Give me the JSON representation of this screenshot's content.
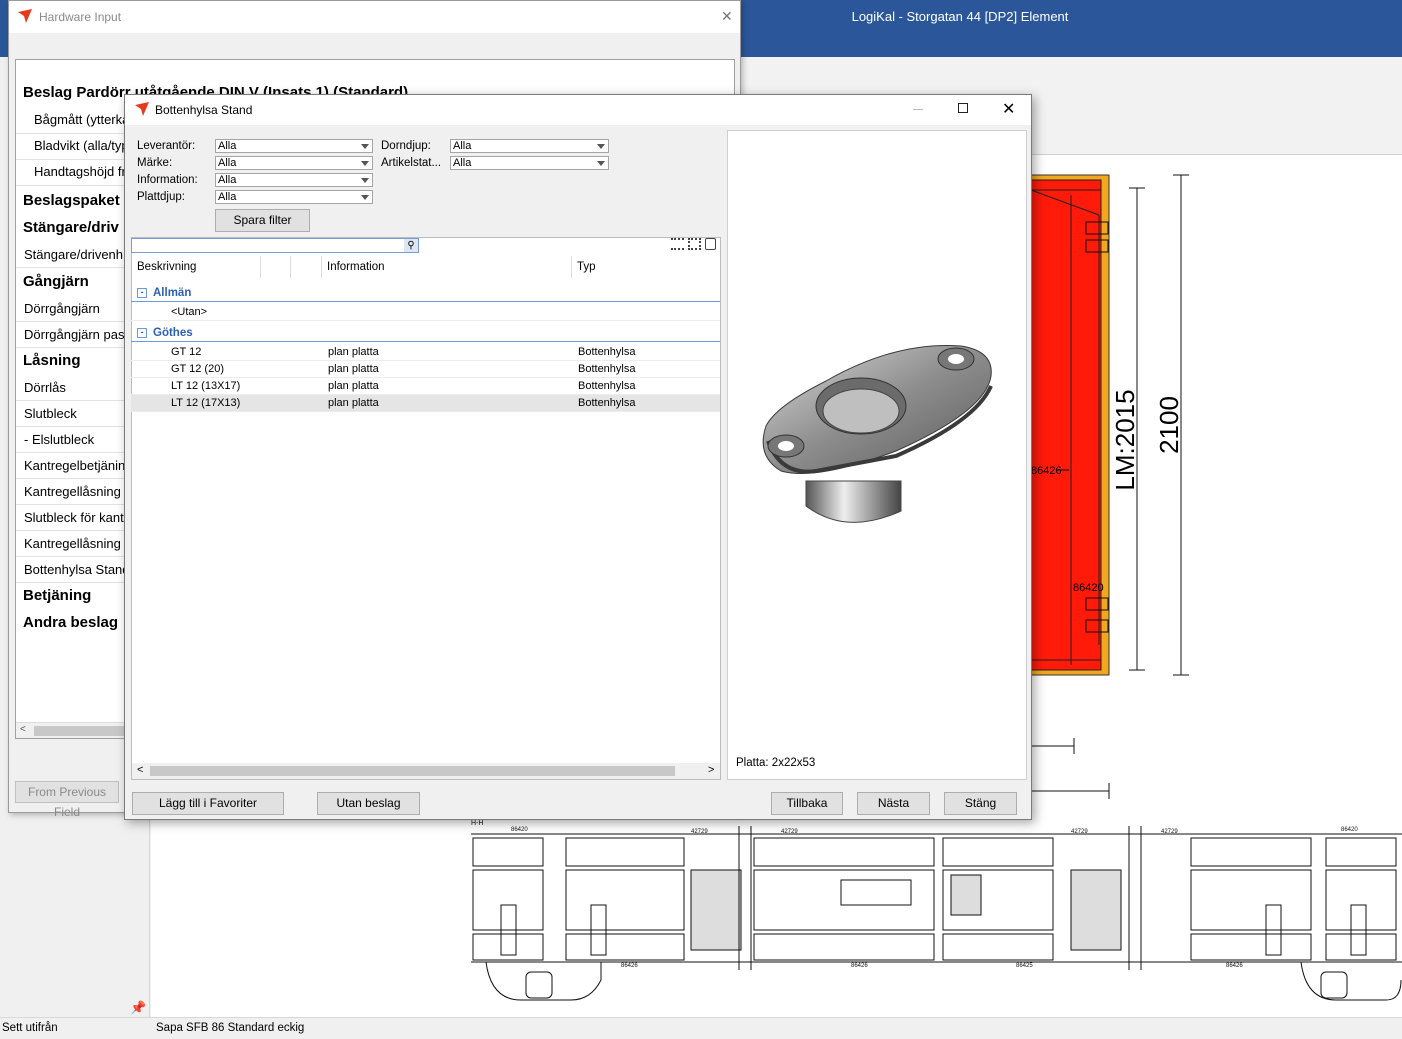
{
  "app": {
    "title": "LogiKal - Storgatan 44 [DP2] Element"
  },
  "status": {
    "left": "Sett utifrån",
    "profile": "Sapa SFB 86  Standard eckig"
  },
  "hw": {
    "title": "Hardware Input",
    "close": "✕",
    "header": "Beslag Pardörr utåtgående DIN V  (Insats 1) (Standard)",
    "items": [
      "Bågmått (ytterka",
      "Bladvikt (alla/typ",
      "Handtagshöjd fr"
    ],
    "sections": [
      "Beslagspaket",
      "Stängare/driv"
    ],
    "items2": [
      "Stängare/drivenh"
    ],
    "section3": "Gångjärn",
    "items3": [
      "Dörrgångjärn",
      "Dörrgångjärn pas"
    ],
    "section4": "Låsning",
    "items4": [
      "Dörrlås",
      "Slutbleck",
      "- Elslutbleck",
      "Kantregelbetjänin",
      "Kantregellåsning",
      "Slutbleck för kant",
      "Kantregellåsning",
      "Bottenhylsa Stand"
    ],
    "section5": "Betjäning",
    "section6": "Andra beslag",
    "prev_btn": "From Previous Field"
  },
  "dlg": {
    "title": "Bottenhylsa Stand",
    "filters": {
      "leverantor_label": "Leverantör:",
      "leverantor": "Alla",
      "marke_label": "Märke:",
      "marke": "Alla",
      "information_label": "Information:",
      "information": "Alla",
      "plattdjup_label": "Plattdjup:",
      "plattdjup": "Alla",
      "dorndjup_label": "Dorndjup:",
      "dorndjup": "Alla",
      "artikelstat_label": "Artikelstat...",
      "artikelstat": "Alla",
      "save_filter": "Spara filter"
    },
    "grid": {
      "col_beskrivning": "Beskrivning",
      "col_information": "Information",
      "col_typ": "Typ",
      "group1": "Allmän",
      "utan": "<Utan>",
      "group2": "Göthes",
      "rows": [
        {
          "desc": "GT 12",
          "info": "plan platta",
          "typ": "Bottenhylsa"
        },
        {
          "desc": "GT 12 (20)",
          "info": "plan platta",
          "typ": "Bottenhylsa"
        },
        {
          "desc": "LT 12 (13X17)",
          "info": "plan platta",
          "typ": "Bottenhylsa"
        },
        {
          "desc": "LT 12 (17X13)",
          "info": "plan platta",
          "typ": "Bottenhylsa"
        }
      ]
    },
    "preview_caption": "Platta: 2x22x53",
    "buttons": {
      "favoriter": "Lägg till i Favoriter",
      "utan_beslag": "Utan beslag",
      "tillbaka": "Tillbaka",
      "nasta": "Nästa",
      "stang": "Stäng"
    }
  },
  "cad": {
    "lm": "LM:2015",
    "height": "2100",
    "dim1": "86426",
    "dim2": "86420",
    "section_label": "H-H",
    "profile_codes": [
      "86420",
      "42729",
      "42729",
      "42729",
      "42729",
      "86420",
      "86426",
      "86426",
      "86425",
      "86426"
    ]
  }
}
